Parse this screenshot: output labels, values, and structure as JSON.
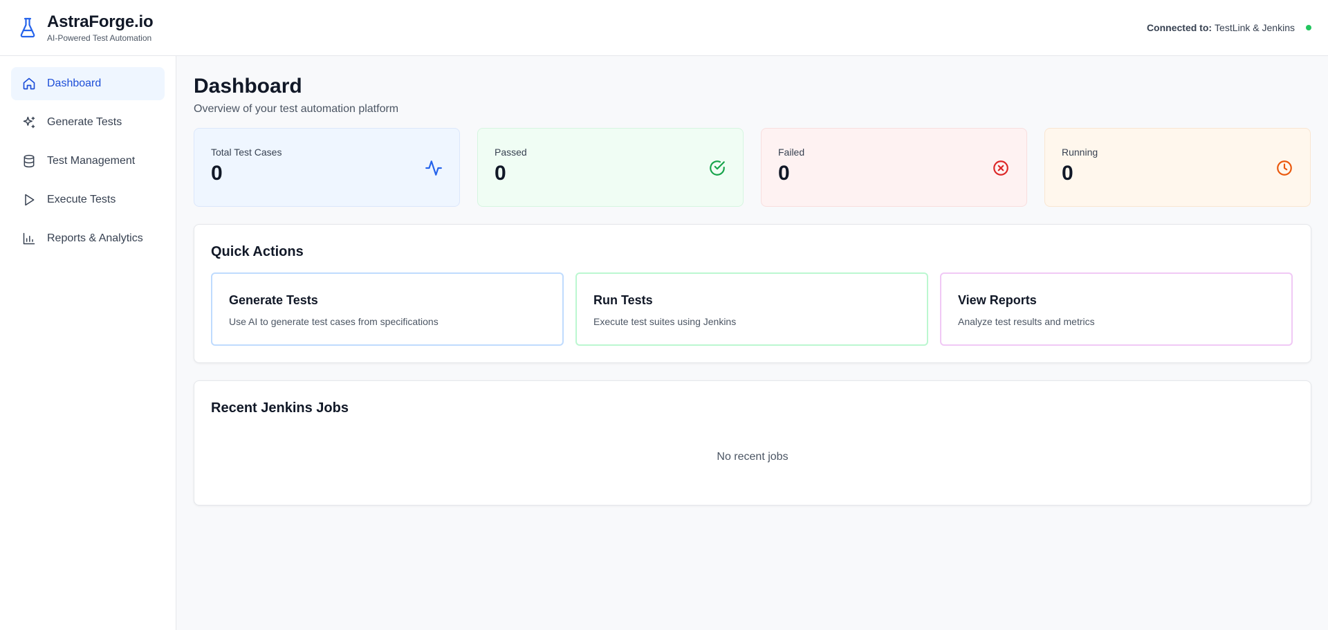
{
  "header": {
    "brand_name": "AstraForge.io",
    "brand_tagline": "AI-Powered Test Automation",
    "connection_label": "Connected to:",
    "connection_value": "TestLink & Jenkins",
    "connection_status_color": "#22c55e",
    "logo_icon": "flask-icon"
  },
  "sidebar": {
    "items": [
      {
        "label": "Dashboard",
        "icon": "home-icon",
        "active": true
      },
      {
        "label": "Generate Tests",
        "icon": "sparkles-icon",
        "active": false
      },
      {
        "label": "Test Management",
        "icon": "database-icon",
        "active": false
      },
      {
        "label": "Execute Tests",
        "icon": "play-icon",
        "active": false
      },
      {
        "label": "Reports & Analytics",
        "icon": "bar-chart-icon",
        "active": false
      }
    ]
  },
  "page": {
    "title": "Dashboard",
    "subtitle": "Overview of your test automation platform"
  },
  "stats": [
    {
      "label": "Total Test Cases",
      "value": "0",
      "icon": "activity-icon",
      "color": "#2563eb"
    },
    {
      "label": "Passed",
      "value": "0",
      "icon": "check-circle-icon",
      "color": "#16a34a"
    },
    {
      "label": "Failed",
      "value": "0",
      "icon": "x-circle-icon",
      "color": "#dc2626"
    },
    {
      "label": "Running",
      "value": "0",
      "icon": "clock-icon",
      "color": "#ea580c"
    }
  ],
  "quick_actions": {
    "title": "Quick Actions",
    "items": [
      {
        "title": "Generate Tests",
        "description": "Use AI to generate test cases from specifications"
      },
      {
        "title": "Run Tests",
        "description": "Execute test suites using Jenkins"
      },
      {
        "title": "View Reports",
        "description": "Analyze test results and metrics"
      }
    ]
  },
  "recent_jobs": {
    "title": "Recent Jenkins Jobs",
    "empty_text": "No recent jobs"
  },
  "colors": {
    "accent": "#1d4ed8",
    "active_nav_bg": "#eff6ff"
  }
}
